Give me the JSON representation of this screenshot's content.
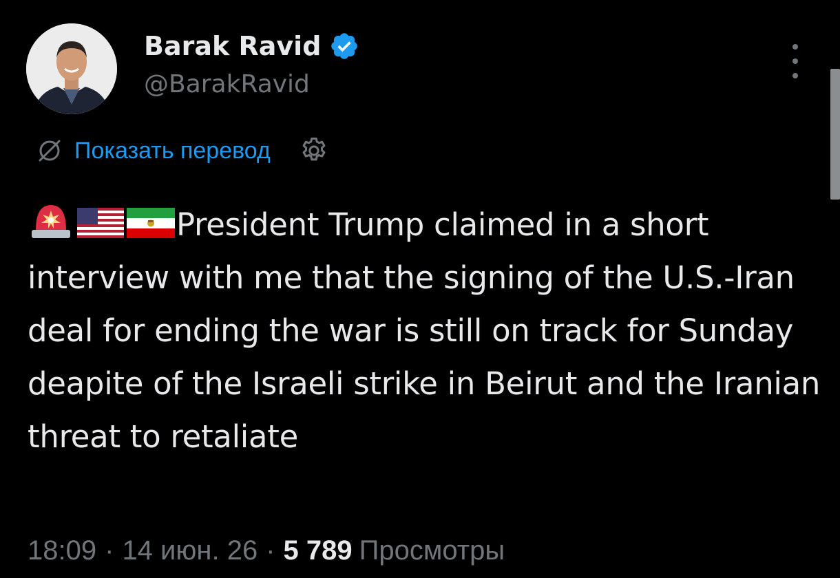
{
  "author": {
    "name": "Barak Ravid",
    "handle": "@BarakRavid"
  },
  "translate": {
    "label": "Показать перевод"
  },
  "tweet": {
    "emojis": [
      "rotating-light-emoji",
      "us-flag-emoji",
      "iran-flag-emoji"
    ],
    "text": "President Trump claimed in a short interview with me that the signing of the U.S.-Iran deal for ending the war is still on track for Sunday deapite of the Israeli strike in Beirut and the Iranian threat to retaliate"
  },
  "meta": {
    "time": "18:09",
    "separator": "·",
    "date": "14 июн. 26",
    "views_count": "5 789",
    "views_label": "Просмотры"
  },
  "colors": {
    "background": "#000000",
    "text": "#e7e9ea",
    "secondary": "#71767b",
    "link": "#1d9bf0",
    "verified": "#1d9bf0"
  }
}
